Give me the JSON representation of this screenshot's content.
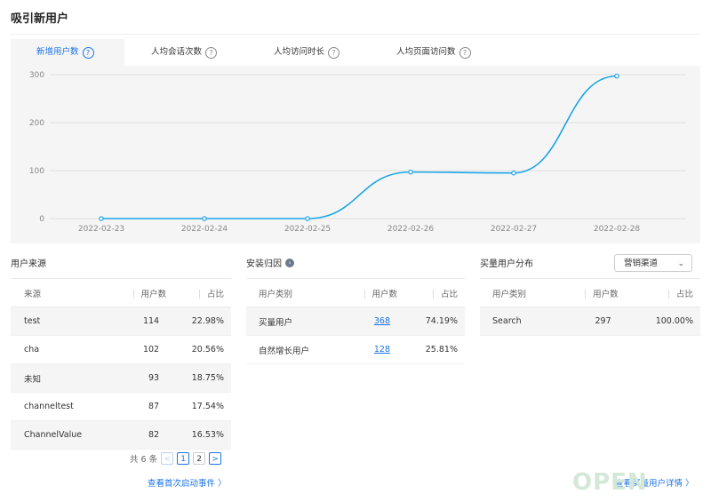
{
  "page": {
    "title": "吸引新用户"
  },
  "tabs": [
    {
      "label": "新增用户数",
      "active": true
    },
    {
      "label": "人均会话次数",
      "active": false
    },
    {
      "label": "人均访问时长",
      "active": false
    },
    {
      "label": "人均页面访问数",
      "active": false
    }
  ],
  "help_glyph": "?",
  "chart_data": {
    "type": "line",
    "x": [
      "2022-02-23",
      "2022-02-24",
      "2022-02-25",
      "2022-02-26",
      "2022-02-27",
      "2022-02-28"
    ],
    "y_ticks": [
      0,
      100,
      200,
      300
    ],
    "ylim": [
      0,
      300
    ],
    "series": [
      {
        "values": [
          0,
          0,
          0,
          97,
          95,
          297
        ]
      }
    ],
    "line_color": "#1aa5e8",
    "grid": "horizontal"
  },
  "sources": {
    "title": "用户来源",
    "headers": [
      "来源",
      "用户数",
      "占比"
    ],
    "rows": [
      [
        "test",
        "114",
        "22.98%"
      ],
      [
        "cha",
        "102",
        "20.56%"
      ],
      [
        "未知",
        "93",
        "18.75%"
      ],
      [
        "channeltest",
        "87",
        "17.54%"
      ],
      [
        "ChannelValue",
        "82",
        "16.53%"
      ]
    ],
    "pager": {
      "total": "共 6 条",
      "prev": "<",
      "pages": [
        "1",
        "2"
      ],
      "next": ">"
    },
    "link": "查看首次启动事件 〉"
  },
  "install": {
    "title": "安装归因",
    "info": "›",
    "headers": [
      "用户类别",
      "用户数",
      "占比"
    ],
    "rows": [
      [
        "买量用户",
        "368",
        "74.19%"
      ],
      [
        "自然增长用户",
        "128",
        "25.81%"
      ]
    ]
  },
  "paid": {
    "title": "买量用户分布",
    "select": "营销渠道",
    "headers": [
      "用户类别",
      "用户数",
      "占比"
    ],
    "rows": [
      [
        "Search",
        "297",
        "100.00%"
      ]
    ],
    "link": "查看买量用户详情 〉"
  },
  "watermark": "OPEN"
}
